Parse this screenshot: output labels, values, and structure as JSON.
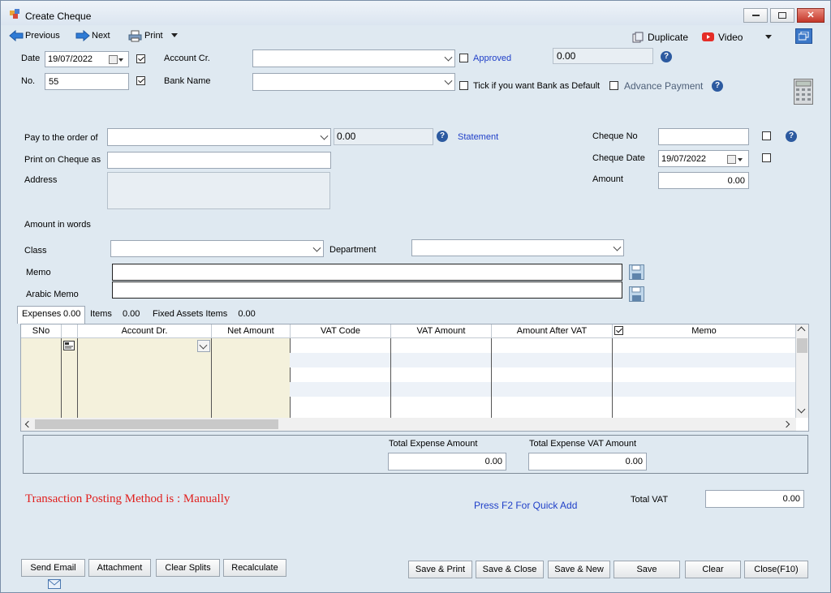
{
  "window": {
    "title": "Create Cheque"
  },
  "toolbar": {
    "previous": "Previous",
    "next": "Next",
    "print": "Print",
    "duplicate": "Duplicate",
    "video": "Video"
  },
  "header": {
    "date_label": "Date",
    "date_value": "19/07/2022",
    "no_label": "No.",
    "no_value": "55",
    "account_cr_label": "Account Cr.",
    "bank_name_label": "Bank Name",
    "approved_label": "Approved",
    "balance_value": "0.00",
    "bank_default_label": "Tick if you want Bank as Default",
    "advance_payment_label": "Advance Payment"
  },
  "payee": {
    "pay_to_label": "Pay to the order of",
    "pay_to_balance": "0.00",
    "statement_link": "Statement",
    "print_on_cheque_label": "Print on Cheque as",
    "address_label": "Address",
    "amount_in_words_label": "Amount in words",
    "class_label": "Class",
    "department_label": "Department",
    "memo_label": "Memo",
    "arabic_memo_label": "Arabic Memo"
  },
  "cheque": {
    "cheque_no_label": "Cheque No",
    "cheque_date_label": "Cheque Date",
    "cheque_date_value": "19/07/2022",
    "amount_label": "Amount",
    "amount_value": "0.00"
  },
  "tabs": [
    {
      "label": "Expenses",
      "value": "0.00"
    },
    {
      "label": "Items",
      "value": "0.00"
    },
    {
      "label": "Fixed Assets Items",
      "value": "0.00"
    }
  ],
  "grid": {
    "columns": [
      "SNo",
      "Account Dr.",
      "Net Amount",
      "VAT Code",
      "VAT Amount",
      "Amount After VAT",
      "Memo"
    ]
  },
  "totals": {
    "total_expense_amount_label": "Total Expense Amount",
    "total_expense_amount_value": "0.00",
    "total_expense_vat_label": "Total Expense VAT Amount",
    "total_expense_vat_value": "0.00",
    "total_vat_label": "Total VAT",
    "total_vat_value": "0.00"
  },
  "status": {
    "posting_method": "Transaction Posting Method is : Manually",
    "quick_add_hint": "Press F2 For Quick Add"
  },
  "buttons": {
    "send_email": "Send Email",
    "attachment": "Attachment",
    "clear_splits": "Clear Splits",
    "recalculate": "Recalculate",
    "save_print": "Save & Print",
    "save_close": "Save & Close",
    "save_new": "Save & New",
    "save": "Save",
    "clear": "Clear",
    "close": "Close(F10)"
  },
  "colors": {
    "window_bg": "#dfe9f1",
    "link": "#1f3fc8",
    "posting_red": "#e0201e",
    "grid_tan": "#f4f1dc"
  }
}
